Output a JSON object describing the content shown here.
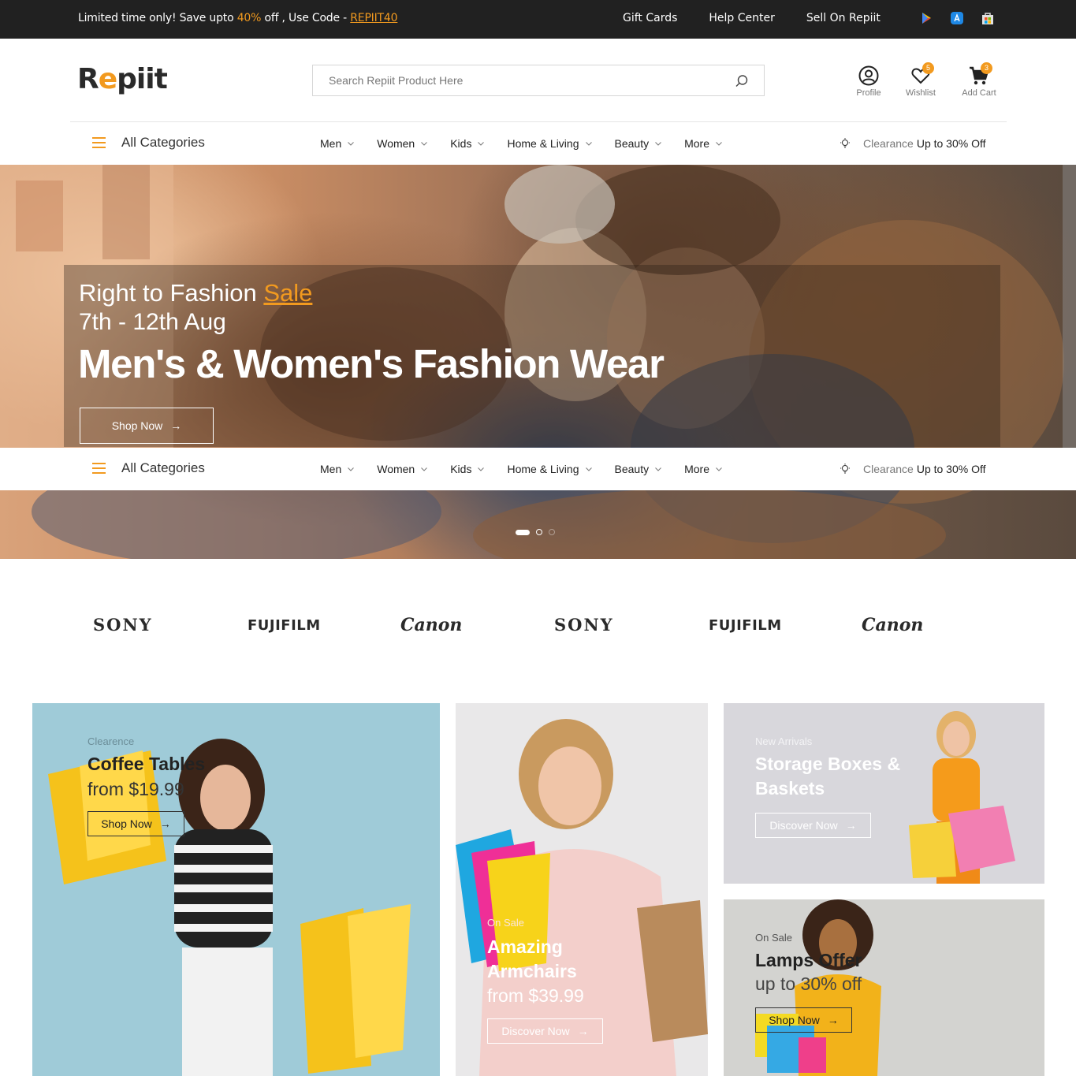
{
  "topbar": {
    "promo_prefix": "Limited time only! Save upto ",
    "promo_percent": "40%",
    "promo_mid": " off , Use Code - ",
    "promo_code": "REPIIT40",
    "links": [
      "Gift Cards",
      "Help Center",
      "Sell On Repiit"
    ],
    "app_icons": [
      "google-play-icon",
      "app-store-icon",
      "microsoft-store-icon"
    ]
  },
  "header": {
    "logo_r": "R",
    "logo_e": "e",
    "logo_rest": "piit",
    "search_placeholder": "Search Repiit Product Here",
    "profile_label": "Profile",
    "wishlist_label": "Wishlist",
    "wishlist_count": "5",
    "cart_label": "Add Cart",
    "cart_count": "3"
  },
  "nav": {
    "all_categories": "All Categories",
    "items": [
      "Men",
      "Women",
      "Kids",
      "Home & Living",
      "Beauty",
      "More"
    ],
    "clearance_label": "Clearance",
    "clearance_offer": "Up to 30% Off"
  },
  "hero": {
    "line1_prefix": "Right to Fashion ",
    "line1_highlight": "Sale",
    "line2": "7th - 12th Aug",
    "headline": "Men's & Women's Fashion Wear",
    "button": "Shop Now",
    "slides": 3,
    "active_slide": 1
  },
  "brands": [
    "SONY",
    "FUJIFILM",
    "Canon",
    "SONY",
    "FUJIFILM",
    "Canon"
  ],
  "cards": [
    {
      "label": "Clearence",
      "title": "Coffee Tables",
      "subtitle": "from $19.99",
      "button": "Shop Now"
    },
    {
      "label": "On Sale",
      "title": "Amazing Armchairs",
      "subtitle": "from $39.99",
      "button": "Discover Now"
    },
    {
      "label": "New Arrivals",
      "title": "Storage Boxes & Baskets",
      "button": "Discover Now"
    },
    {
      "label": "On Sale",
      "title": "Lamps Offer",
      "subtitle": "up to 30% off",
      "button": "Shop Now"
    }
  ],
  "colors": {
    "accent": "#f29a1f",
    "topbar_bg": "#212121"
  }
}
